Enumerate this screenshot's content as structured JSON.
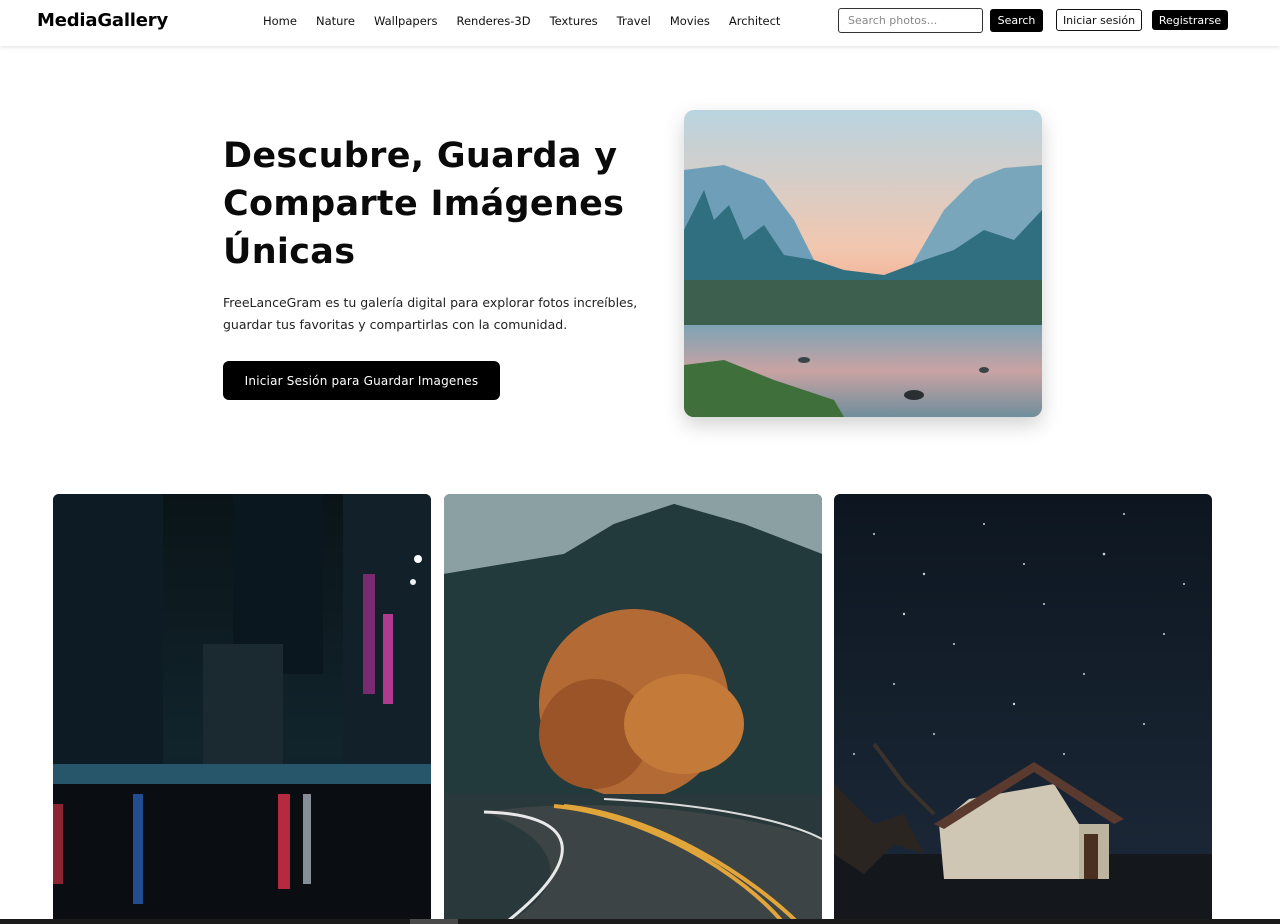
{
  "header": {
    "logo": "MediaGallery",
    "nav": [
      "Home",
      "Nature",
      "Wallpapers",
      "Renderes-3D",
      "Textures",
      "Travel",
      "Movies",
      "Architect"
    ],
    "search_placeholder": "Search photos...",
    "search_button": "Search",
    "login_button": "Iniciar sesión",
    "register_button": "Registrarse"
  },
  "hero": {
    "title": "Descubre, Guarda y Comparte Imágenes Únicas",
    "description": "FreeLanceGram es tu galería digital para explorar fotos increíbles, guardar tus favoritas y compartirlas con la comunidad.",
    "cta": "Iniciar Sesión para Guardar Imagenes",
    "image": "valley-river-sunset-photo"
  },
  "gallery": [
    {
      "image": "night-city-street-rain-photo"
    },
    {
      "image": "autumn-tree-curved-road-photo"
    },
    {
      "image": "starry-sky-old-house-photo"
    }
  ]
}
